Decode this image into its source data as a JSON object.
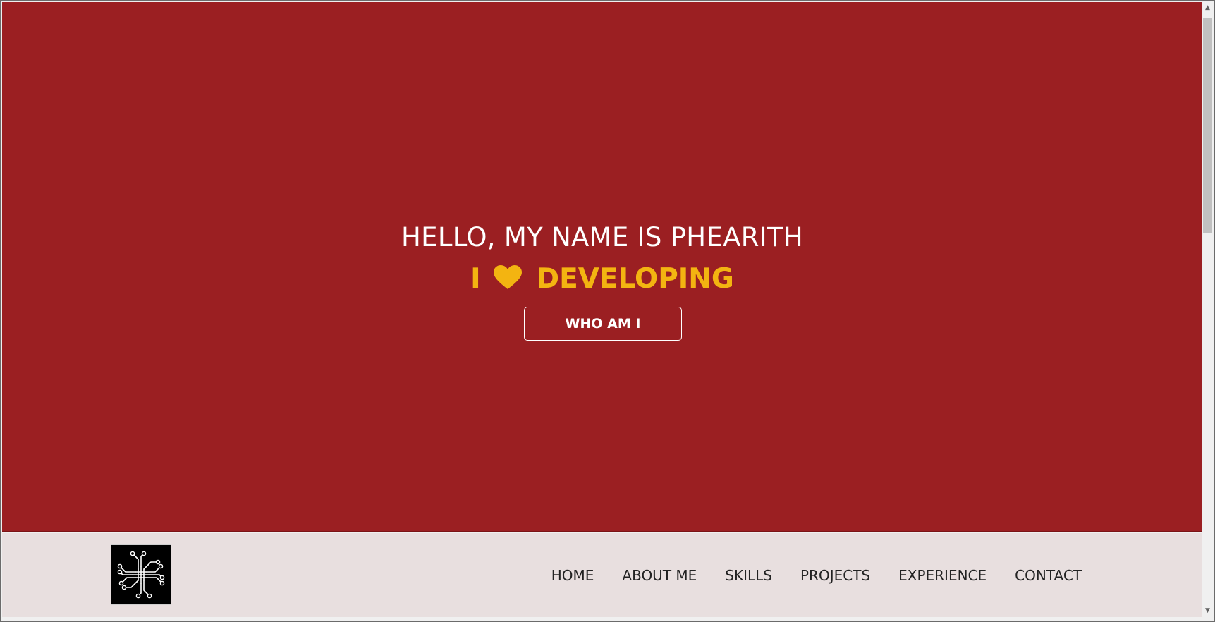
{
  "hero": {
    "greeting": "HELLO, MY NAME IS PHEARITH",
    "tagline_prefix": "I",
    "tagline_suffix": "DEVELOPING",
    "heart_icon": "heart-icon",
    "cta_label": "WHO AM I"
  },
  "navbar": {
    "logo": "circuit-logo",
    "items": [
      {
        "label": "HOME"
      },
      {
        "label": "ABOUT ME"
      },
      {
        "label": "SKILLS"
      },
      {
        "label": "PROJECTS"
      },
      {
        "label": "EXPERIENCE"
      },
      {
        "label": "CONTACT"
      }
    ]
  },
  "colors": {
    "hero_bg": "#9b1f22",
    "accent": "#f3b411",
    "navbar_bg": "#e8dfdf"
  }
}
